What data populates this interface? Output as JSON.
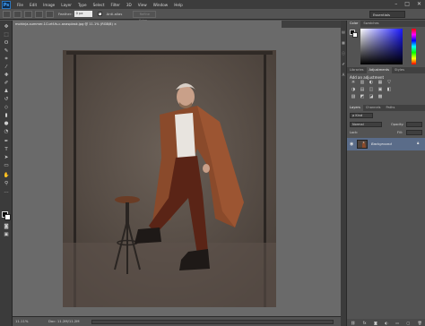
{
  "app": {
    "logo": "Ps"
  },
  "menu": {
    "items": [
      "File",
      "Edit",
      "Image",
      "Layer",
      "Type",
      "Select",
      "Filter",
      "3D",
      "View",
      "Window",
      "Help"
    ]
  },
  "window_controls": {
    "minimize": "–",
    "maximize": "□",
    "close": "✕"
  },
  "options": {
    "feather_label": "Feather:",
    "feather_value": "0 px",
    "antialias_label": "Anti-alias",
    "refine_edge_label": "Refine Edge...",
    "workspace": "Essentials"
  },
  "document": {
    "tab_title": "mohinja-summer-1Curtf-fs-c-anasplask.jpg @ 11.1% (RGB/8) ×",
    "zoom": "11.11%",
    "doc_info": "Doc: 11.2M/11.2M"
  },
  "panels": {
    "color_tabs": [
      "Color",
      "Swatches"
    ],
    "adjust_tabs": [
      "Libraries",
      "Adjustments",
      "Styles"
    ],
    "adjust_title": "Add an adjustment",
    "adj_icons": [
      "☀",
      "▥",
      "◐",
      "▦",
      "▽",
      "◑",
      "▤",
      "◫",
      "▣",
      "◧",
      "▨",
      "◩",
      "◪",
      "▩"
    ],
    "layers_tabs": [
      "Layers",
      "Channels",
      "Paths"
    ],
    "kind_label": "ρ Kind",
    "blend_mode": "Normal",
    "opacity_label": "Opacity:",
    "opacity_value": "",
    "lock_label": "Lock:",
    "fill_label": "Fill:",
    "fill_value": "",
    "layer_name": "Background",
    "footer_icons": [
      "⛓",
      "fx",
      "◙",
      "◐",
      "▭",
      "▢",
      "🗑"
    ]
  },
  "colors": {
    "foreground": "#000000",
    "background": "#ffffff",
    "selected_layer": "#5a6c89"
  }
}
